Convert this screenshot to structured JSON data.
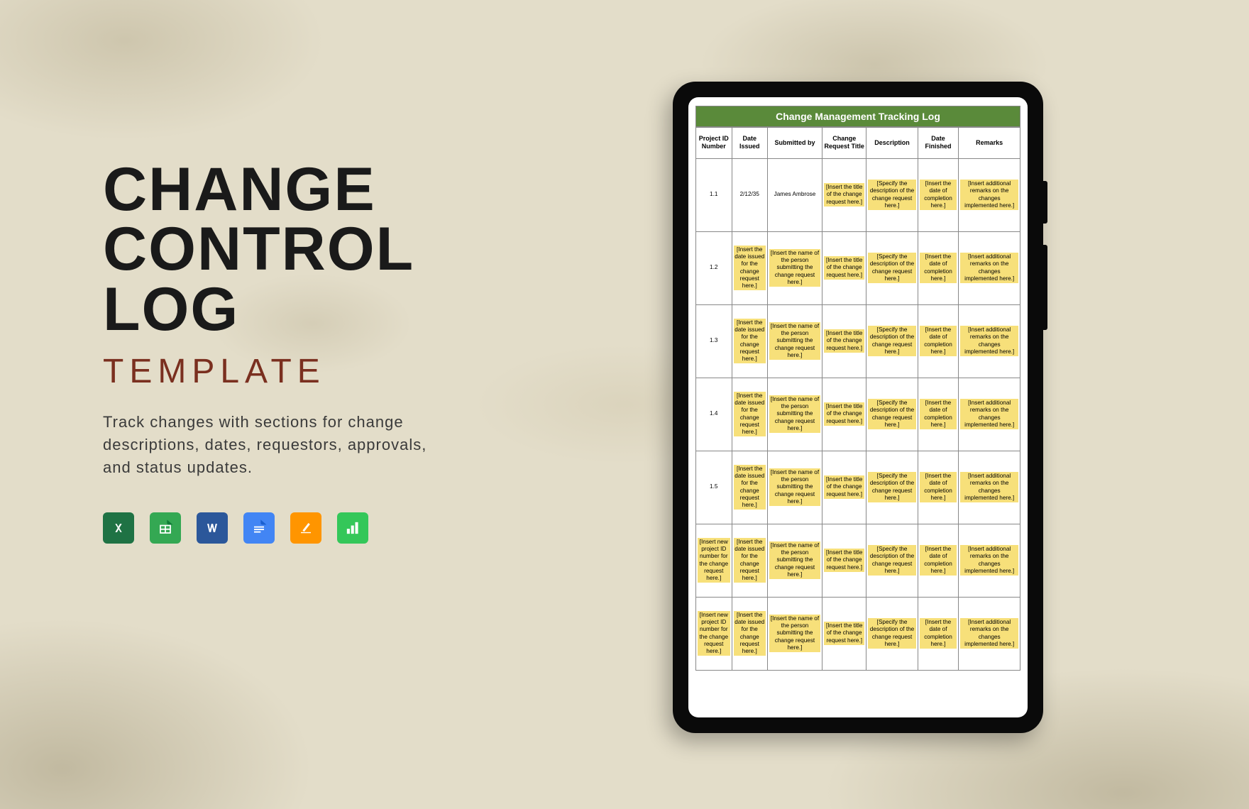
{
  "left": {
    "title_line1": "CHANGE",
    "title_line2": "CONTROL",
    "title_line3": "LOG",
    "subtitle": "TEMPLATE",
    "description": "Track changes with sections for change descriptions, dates, requestors, approvals, and status updates."
  },
  "icons": [
    {
      "name": "excel-icon",
      "bg": "#1f7244"
    },
    {
      "name": "sheets-icon",
      "bg": "#34a853"
    },
    {
      "name": "word-icon",
      "bg": "#2b579a"
    },
    {
      "name": "docs-icon",
      "bg": "#4285f4"
    },
    {
      "name": "pages-icon",
      "bg": "#ff9500"
    },
    {
      "name": "numbers-icon",
      "bg": "#34c759"
    }
  ],
  "table": {
    "caption": "Change Management Tracking Log",
    "headers": [
      "Project ID Number",
      "Date Issued",
      "Submitted by",
      "Change Request Title",
      "Description",
      "Date Finished",
      "Remarks"
    ],
    "placeholders": {
      "project_id": "[Insert new project ID number for the change request here.]",
      "date_issued": "[Insert the date issued for the change request here.]",
      "submitted_by": "[Insert the name of the person submitting the change request here.]",
      "title": "[Insert the title of the change request here.]",
      "description": "[Specify the description of the change request here.]",
      "date_finished": "[Insert the date of completion here.]",
      "remarks": "[Insert additional remarks on the changes implemented here.]"
    },
    "rows": [
      {
        "pid": "1.1",
        "pid_hl": false,
        "date": "2/12/35",
        "date_hl": false,
        "by": "James Ambrose",
        "by_hl": false
      },
      {
        "pid": "1.2",
        "pid_hl": false
      },
      {
        "pid": "1.3",
        "pid_hl": false
      },
      {
        "pid": "1.4",
        "pid_hl": false
      },
      {
        "pid": "1.5",
        "pid_hl": false
      },
      {
        "pid_hl": true
      },
      {
        "pid_hl": true
      }
    ]
  }
}
